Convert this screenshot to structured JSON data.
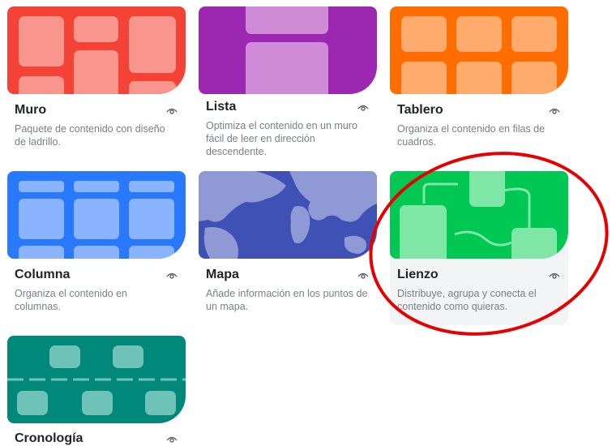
{
  "layouts": [
    {
      "id": "wall",
      "title": "Muro",
      "description": "Paquete de contenido con diseño de ladrillo."
    },
    {
      "id": "stream",
      "title": "Lista",
      "description": "Optimiza el contenido en un muro fácil de leer en dirección descendente."
    },
    {
      "id": "grid",
      "title": "Tablero",
      "description": "Organiza el contenido en filas de cuadros."
    },
    {
      "id": "shelf",
      "title": "Columna",
      "description": "Organiza el contenido en columnas."
    },
    {
      "id": "map",
      "title": "Mapa",
      "description": "Añade información en los puntos de un mapa."
    },
    {
      "id": "canvas",
      "title": "Lienzo",
      "description": "Distribuye, agrupa y conecta el contenido como quieras."
    },
    {
      "id": "timeline",
      "title": "Cronología",
      "description": ""
    }
  ],
  "icons": {
    "preview": "eye-icon"
  },
  "colors": {
    "wall": "#f44336",
    "stream": "#9c27b0",
    "grid": "#ff6d00",
    "shelf": "#2979ff",
    "map": "#3f51b5",
    "canvas": "#00c853",
    "timeline": "#00897b",
    "annotation": "#e60000"
  }
}
